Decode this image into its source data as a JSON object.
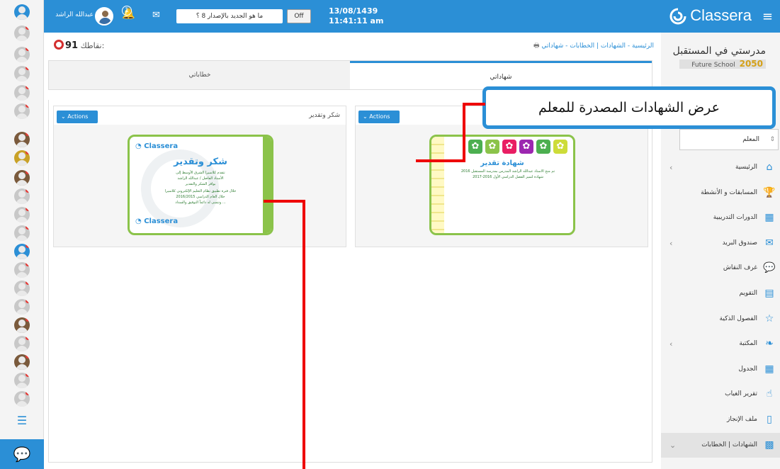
{
  "topbar": {
    "user_name": "عبدالله الراشد",
    "notification_count": "1",
    "whats_new": "ما هو الجديد بالإصدار 8 ؟",
    "toggle_label": "Off",
    "date": "13/08/1439",
    "time": "11:41:11 am",
    "brand": "Classera",
    "menu_icon": "hamburger-icon"
  },
  "content": {
    "points_label": "نقاطك:",
    "points_value": "91",
    "breadcrumb": "الرئيسية - الشهادات | الخطابات - شهاداتي",
    "tabs": [
      {
        "label": "شهاداتي",
        "active": true
      },
      {
        "label": "خطاباتي",
        "active": false
      }
    ],
    "cards": [
      {
        "title": "",
        "actions_label": "Actions",
        "certificate": {
          "heading": "شهادة تقدير",
          "lines": [
            "تم منح الاستاذ عبدالله الراشد المدرس بمدرسة المستقبل 2016",
            "شهادة لتميز الفصل الدراسي الأول 2016-2017"
          ]
        }
      },
      {
        "title": "شكر وتقدير",
        "actions_label": "Actions",
        "certificate": {
          "brand": "Classera",
          "heading": "شكر وتقدير",
          "lines": [
            "تتقدم كلاسيرا الشرق الأوسط إلى",
            "الأستاذ الفاضل / عبدالله الراشد",
            "بوافر الشكر والتقدير",
            "خلال فترة تطبيق نظام التعليم الإلكتروني كلاسيرا",
            "خلال العام الدراسي 2016/2015",
            "ونتمنى له دائماً التوفيق والسداد ..."
          ]
        }
      }
    ]
  },
  "callout": "عرض الشهادات المصدرة للمعلم",
  "sidebar": {
    "school_name": "مدرستي في المستقبل",
    "school_sub": "Future School",
    "school_year": "2050",
    "role": "المعلم",
    "items": [
      {
        "label": "الرئيسية",
        "icon": "home-icon",
        "chevron": true
      },
      {
        "label": "المسابقات و الأنشطة",
        "icon": "trophy-icon",
        "chevron": false
      },
      {
        "label": "الدورات التدريبية",
        "icon": "grid-icon",
        "chevron": false
      },
      {
        "label": "صندوق البريد",
        "icon": "mail-icon",
        "chevron": true
      },
      {
        "label": "غرف النقاش",
        "icon": "chat-icon",
        "chevron": false
      },
      {
        "label": "التقويم",
        "icon": "calendar-icon",
        "chevron": false
      },
      {
        "label": "الفصول الذكية",
        "icon": "star-icon",
        "chevron": false
      },
      {
        "label": "المكتبة",
        "icon": "leaf-icon",
        "chevron": true
      },
      {
        "label": "الجدول",
        "icon": "table-icon",
        "chevron": false
      },
      {
        "label": "تقرير الغياب",
        "icon": "hand-icon",
        "chevron": false
      },
      {
        "label": "ملف الإنجاز",
        "icon": "file-icon",
        "chevron": false
      },
      {
        "label": "الشهادات | الخطابات",
        "icon": "qr-icon",
        "chevron": true
      }
    ]
  }
}
